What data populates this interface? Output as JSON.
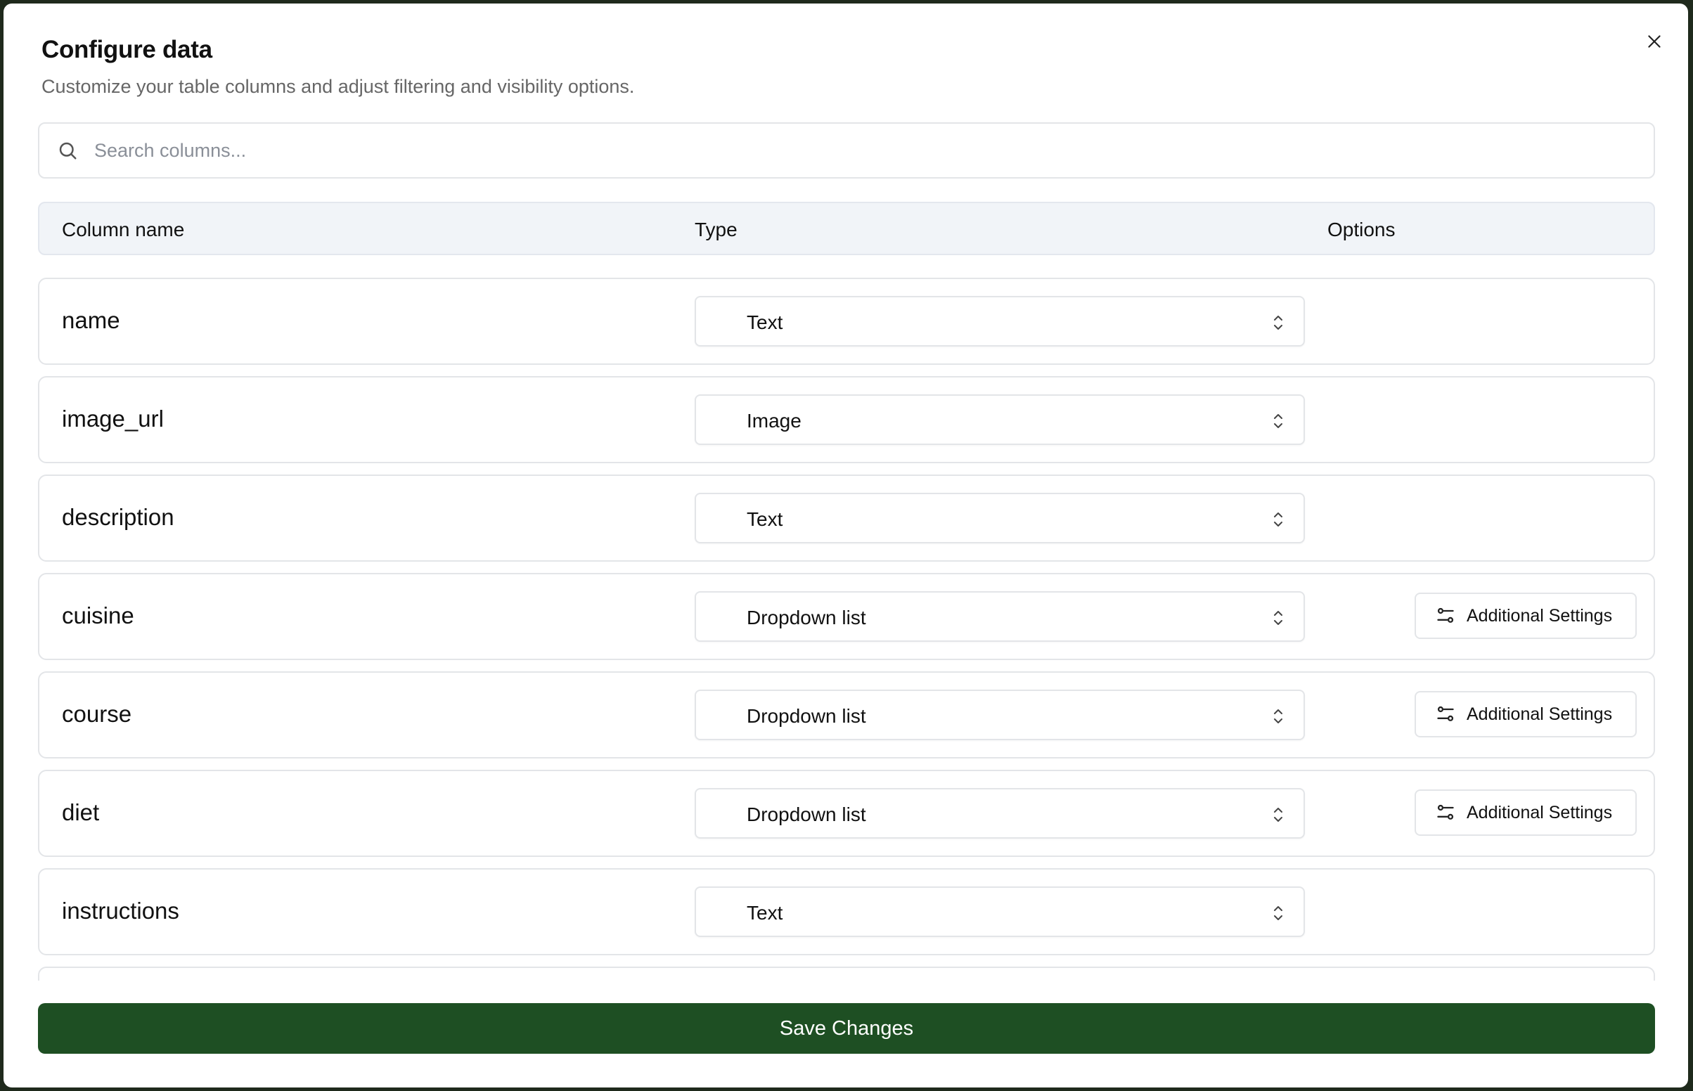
{
  "dialog": {
    "title": "Configure data",
    "subtitle": "Customize your table columns and adjust filtering and visibility options.",
    "close_icon": "close-icon"
  },
  "search": {
    "placeholder": "Search columns...",
    "value": "",
    "icon": "search-icon"
  },
  "table": {
    "headers": {
      "column_name": "Column name",
      "type": "Type",
      "options": "Options"
    },
    "rows": [
      {
        "name": "name",
        "type": "Text",
        "has_settings": false
      },
      {
        "name": "image_url",
        "type": "Image",
        "has_settings": false
      },
      {
        "name": "description",
        "type": "Text",
        "has_settings": false
      },
      {
        "name": "cuisine",
        "type": "Dropdown list",
        "has_settings": true
      },
      {
        "name": "course",
        "type": "Dropdown list",
        "has_settings": true
      },
      {
        "name": "diet",
        "type": "Dropdown list",
        "has_settings": true
      },
      {
        "name": "instructions",
        "type": "Text",
        "has_settings": false
      },
      {
        "name": "",
        "type": "",
        "has_settings": false
      }
    ],
    "settings_label": "Additional Settings",
    "settings_icon": "sliders-icon",
    "select_icon": "chevron-up-down-icon"
  },
  "footer": {
    "save_label": "Save Changes"
  },
  "colors": {
    "primary": "#1e4f23",
    "header_bg": "#f1f4f8",
    "border": "#e3e5e8"
  }
}
